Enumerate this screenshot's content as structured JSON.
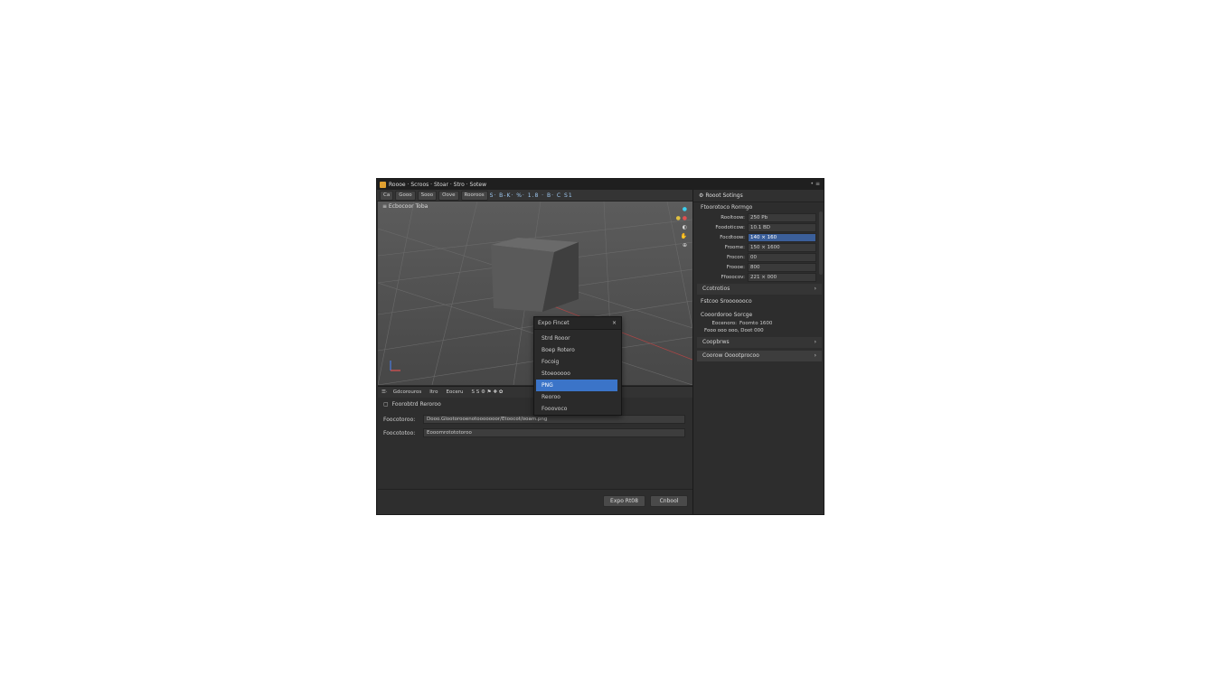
{
  "window": {
    "title": "Roooe · Scroos · Stoar · Stro · Sotew",
    "controls": "• ≡"
  },
  "toolbar": {
    "mode": "Ca",
    "menus": [
      "Gooo",
      "Sooo",
      "Oove",
      "Rooroos"
    ],
    "icons": "S· B-K· %· 1.8 · B· C S1"
  },
  "viewport": {
    "label": "≡ Ecbocoor Toba"
  },
  "bottom_panel": {
    "tabs": [
      "Gdcorouros",
      "Itro",
      "Eoceru"
    ],
    "tool_icons": "S S ⚙ ⚑ ✚ ✿",
    "section": "Foorobtrd Reroroo",
    "rows": [
      {
        "label": "Foocotoroo:",
        "value": "Dooo.Glootorooenotooooooor/Etoocot/ooam.png"
      },
      {
        "label": "Foocototoo:",
        "value": "Eooomrotototoroo"
      }
    ],
    "primary_button": "Expo Rt08",
    "cancel_button": "Cnbool"
  },
  "format_popup": {
    "title": "Expo Fincet",
    "items": [
      "Strd Rooor",
      "Boep Rotero",
      "Focoig",
      "Stoeooooo",
      "PNG",
      "Reoroo",
      "Fooovoco"
    ],
    "selected_index": 4
  },
  "right_panel": {
    "title": "Rooot Sotings",
    "section1": "Ftoorotoco Rormgo",
    "properties": [
      {
        "label": "Rooltoow:",
        "value": "250 Pb"
      },
      {
        "label": "Foodoticow:",
        "value": "10.1 BD"
      },
      {
        "label": "Focdtoow:",
        "value": "140 × 160"
      },
      {
        "label": "Froome:",
        "value": "150 × 1600"
      },
      {
        "label": "Frocon:",
        "value": "00"
      },
      {
        "label": "Froooe:",
        "value": "800"
      },
      {
        "label": "Ffooocov:",
        "value": "221 × 000"
      }
    ],
    "section2": "Ccotrotios",
    "section3": "Fstcoo Srooooooco",
    "section4": "Cooordoroo Sorcge",
    "sub1": {
      "label": "Eocenoro:",
      "value": "Foomto 1600"
    },
    "sub2": "Fooo ooo ooo, Doot 000",
    "section5": "Coopbrws",
    "section6": "Coorow Ooootprocoo"
  }
}
